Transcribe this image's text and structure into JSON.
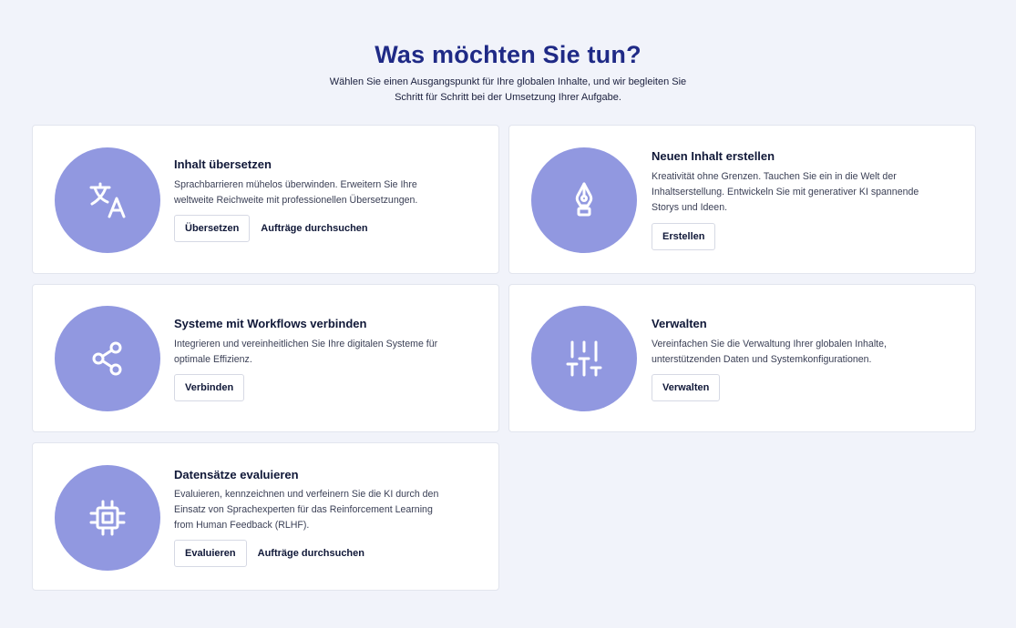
{
  "header": {
    "title": "Was möchten Sie tun?",
    "subtitle_line1": "Wählen Sie einen Ausgangspunkt für Ihre globalen Inhalte, und wir begleiten Sie",
    "subtitle_line2": "Schritt für Schritt bei der Umsetzung Ihrer Aufgabe."
  },
  "cards": [
    {
      "title": "Inhalt übersetzen",
      "desc_lines": [
        "Sprachbarrieren mühelos überwinden. Erweitern Sie Ihre",
        "weltweite Reichweite mit professionellen Übersetzungen."
      ],
      "button": "Übersetzen",
      "link": "Aufträge durchsuchen",
      "icon": "translate-icon"
    },
    {
      "title": "Neuen Inhalt erstellen",
      "desc_lines": [
        "Kreativität ohne Grenzen. Tauchen Sie ein in die Welt der",
        "Inhaltserstellung. Entwickeln Sie mit generativer KI spannende",
        "Storys und Ideen."
      ],
      "button": "Erstellen",
      "icon": "pen-nib-icon"
    },
    {
      "title": "Systeme mit Workflows verbinden",
      "desc_lines": [
        "Integrieren und vereinheitlichen Sie Ihre digitalen Systeme für",
        "optimale Effizienz."
      ],
      "button": "Verbinden",
      "icon": "share-icon"
    },
    {
      "title": "Verwalten",
      "desc_lines": [
        "Vereinfachen Sie die Verwaltung Ihrer globalen Inhalte,",
        "unterstützenden Daten und Systemkonfigurationen."
      ],
      "button": "Verwalten",
      "icon": "sliders-icon"
    },
    {
      "title": "Datensätze evaluieren",
      "desc_lines": [
        "Evaluieren, kennzeichnen und verfeinern Sie die KI durch den",
        "Einsatz von Sprachexperten für das Reinforcement Learning",
        "from Human Feedback (RLHF)."
      ],
      "button": "Evaluieren",
      "link": "Aufträge durchsuchen",
      "icon": "chip-icon"
    }
  ]
}
